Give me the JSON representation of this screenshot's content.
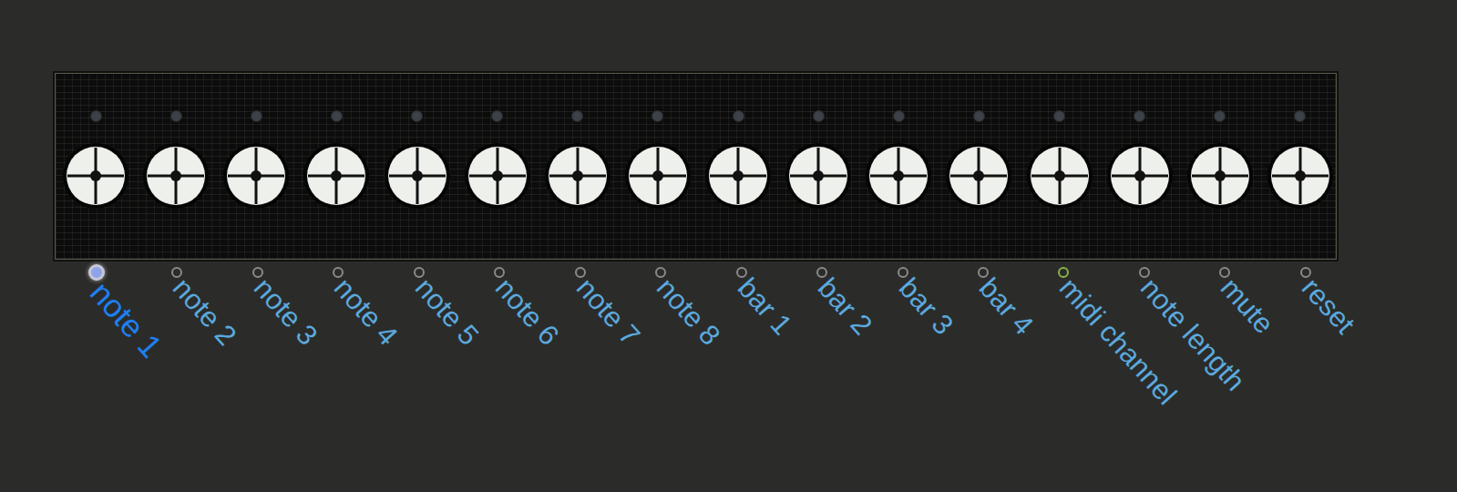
{
  "ports": [
    {
      "label": "note 1",
      "selected": true,
      "color": "#8fa4e8"
    },
    {
      "label": "note 2",
      "selected": false,
      "color": "#8a8a8a"
    },
    {
      "label": "note 3",
      "selected": false,
      "color": "#8a8a8a"
    },
    {
      "label": "note 4",
      "selected": false,
      "color": "#8a8a8a"
    },
    {
      "label": "note 5",
      "selected": false,
      "color": "#8a8a8a"
    },
    {
      "label": "note 6",
      "selected": false,
      "color": "#8a8a8a"
    },
    {
      "label": "note 7",
      "selected": false,
      "color": "#8a8a8a"
    },
    {
      "label": "note 8",
      "selected": false,
      "color": "#8a8a8a"
    },
    {
      "label": "bar 1",
      "selected": false,
      "color": "#8a8a8a"
    },
    {
      "label": "bar 2",
      "selected": false,
      "color": "#8a8a8a"
    },
    {
      "label": "bar 3",
      "selected": false,
      "color": "#8a8a8a"
    },
    {
      "label": "bar 4",
      "selected": false,
      "color": "#8a8a8a"
    },
    {
      "label": "midi channel",
      "selected": false,
      "color": "#8db04a"
    },
    {
      "label": "note length",
      "selected": false,
      "color": "#8a8a8a"
    },
    {
      "label": "mute",
      "selected": false,
      "color": "#8a8a8a"
    },
    {
      "label": "reset",
      "selected": false,
      "color": "#8a8a8a"
    }
  ]
}
